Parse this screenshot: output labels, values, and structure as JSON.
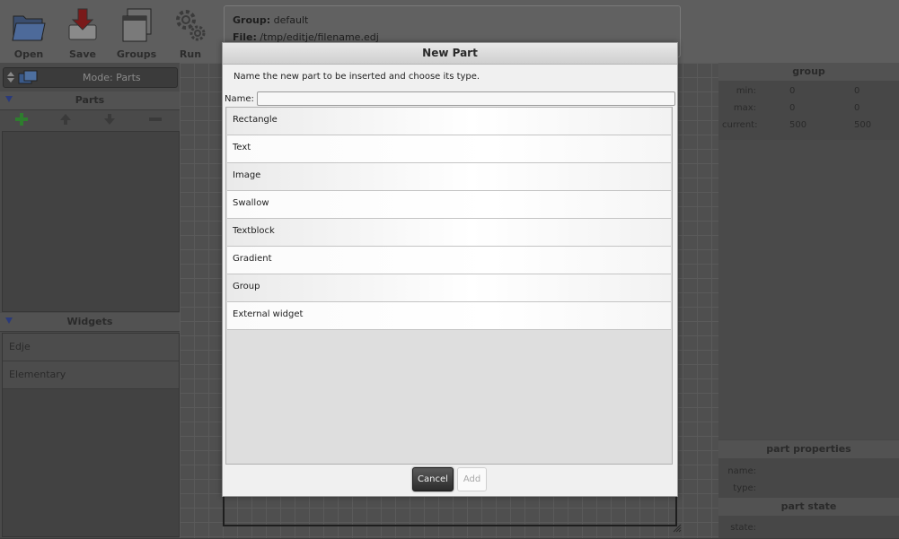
{
  "toolbar": {
    "open_label": "Open",
    "save_label": "Save",
    "groups_label": "Groups",
    "run_label": "Run"
  },
  "group_info": {
    "group_key": "Group:",
    "group_value": "default",
    "file_key": "File:",
    "file_value": "/tmp/editje/filename.edj"
  },
  "left_panel": {
    "mode_label": "Mode: Parts",
    "parts_title": "Parts",
    "widgets_title": "Widgets",
    "widgets": [
      "Edje",
      "Elementary"
    ]
  },
  "right_panel": {
    "group_title": "group",
    "rows": [
      {
        "label": "min:",
        "v1": "0",
        "v2": "0"
      },
      {
        "label": "max:",
        "v1": "0",
        "v2": "0"
      },
      {
        "label": "current:",
        "v1": "500",
        "v2": "500"
      }
    ],
    "part_properties_title": "part properties",
    "name_label": "name:",
    "type_label": "type:",
    "part_state_title": "part state",
    "state_label": "state:"
  },
  "dialog": {
    "title": "New Part",
    "description": "Name the new part to be inserted and choose its type.",
    "name_label": "Name:",
    "name_value": "",
    "types": [
      "Rectangle",
      "Text",
      "Image",
      "Swallow",
      "Textblock",
      "Gradient",
      "Group",
      "External widget"
    ],
    "cancel_label": "Cancel",
    "add_label": "Add"
  }
}
